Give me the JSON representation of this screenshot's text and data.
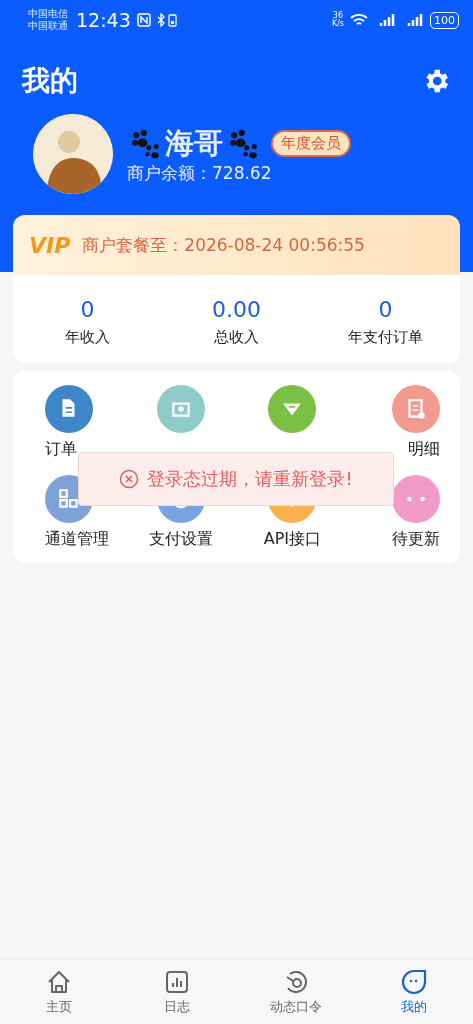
{
  "status_bar": {
    "carriers": [
      "中国电信",
      "中国联通"
    ],
    "time": "12:43",
    "speed": "36",
    "speed_unit": "K/s",
    "battery": "100"
  },
  "header": {
    "title": "我的"
  },
  "profile": {
    "name": "海哥",
    "badge": "年度会员",
    "balance": "商户余额：728.62"
  },
  "vip": {
    "logo": "VIP",
    "text": "商户套餐至：2026-08-24 00:56:55"
  },
  "stats": [
    {
      "value": "0",
      "label": "年收入"
    },
    {
      "value": "0.00",
      "label": "总收入"
    },
    {
      "value": "0",
      "label": "年支付订单"
    }
  ],
  "menu": [
    {
      "label": "订单",
      "color": "#3f86c9",
      "kind": "doc"
    },
    {
      "color": "#8fcbc8",
      "kind": "bag"
    },
    {
      "color": "#7bbf45",
      "kind": "gem"
    },
    {
      "label": "明细",
      "color": "#f29a90",
      "kind": "clip"
    },
    {
      "label": "通道管理",
      "color": "#7fa3d9",
      "kind": "grid"
    },
    {
      "label": "支付设置",
      "color": "#78a3e0",
      "kind": "ring"
    },
    {
      "label": "API接口",
      "color": "#fbb24c",
      "kind": "dot"
    },
    {
      "label": "待更新",
      "color": "#f19cc8",
      "kind": "more"
    }
  ],
  "toast": {
    "text": "登录态过期，请重新登录!"
  },
  "tabs": [
    {
      "label": "主页",
      "kind": "home",
      "selected": false
    },
    {
      "label": "日志",
      "kind": "chart",
      "selected": false
    },
    {
      "label": "动态口令",
      "kind": "key",
      "selected": false
    },
    {
      "label": "我的",
      "kind": "face",
      "selected": true
    }
  ]
}
